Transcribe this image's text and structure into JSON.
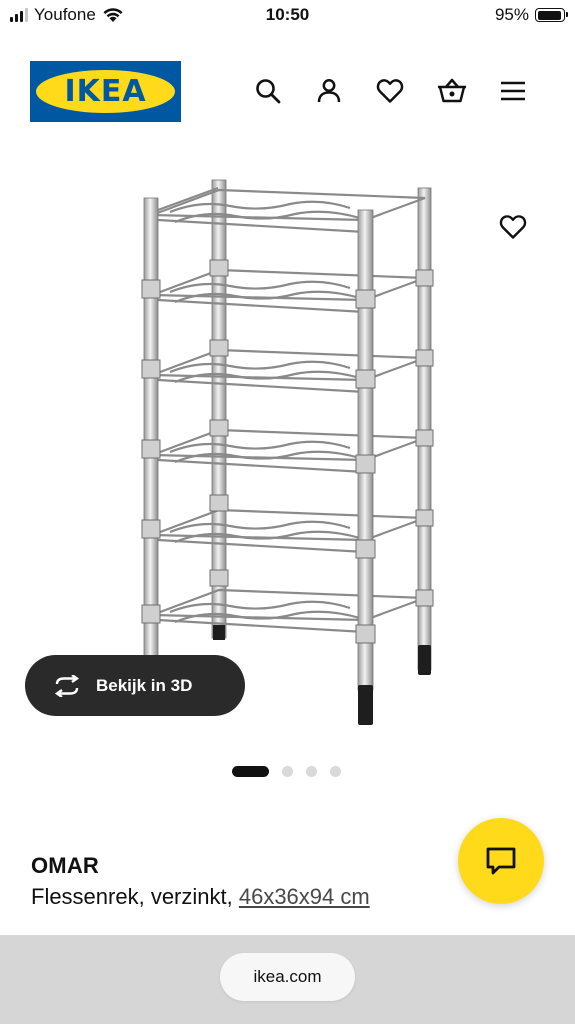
{
  "status_bar": {
    "carrier": "Youfone",
    "time": "10:50",
    "battery_percent": "95%",
    "battery_level": 0.95,
    "signal_bars_active": 3
  },
  "header": {
    "logo_text": "IKEA",
    "icons": [
      "search-icon",
      "user-icon",
      "heart-icon",
      "shopping-basket-icon",
      "menu-icon"
    ]
  },
  "gallery": {
    "view_3d_label": "Bekijk in 3D",
    "image_count": 4,
    "active_index": 0
  },
  "product": {
    "name": "OMAR",
    "description": "Flessenrek, verzinkt, ",
    "size": "46x36x94 cm"
  },
  "browser": {
    "url": "ikea.com"
  },
  "colors": {
    "ikea_blue": "#0058a3",
    "ikea_yellow": "#ffda1a",
    "dark_button": "#2a2a2a"
  }
}
